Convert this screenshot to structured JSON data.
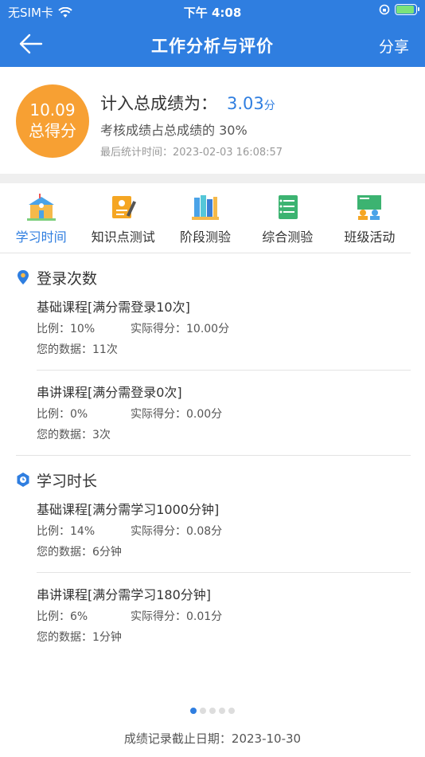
{
  "status": {
    "carrier": "无SIM卡",
    "time": "下午 4:08"
  },
  "nav": {
    "title": "工作分析与评价",
    "share": "分享"
  },
  "score": {
    "total": "10.09",
    "total_label": "总得分",
    "headline": "计入总成绩为：",
    "value": "3.03",
    "unit": "分",
    "subtitle": "考核成绩占总成绩的 30%",
    "stat_time": "最后统计时间：2023-02-03 16:08:57"
  },
  "tabs": [
    {
      "label": "学习时间",
      "icon": "school-icon",
      "active": true
    },
    {
      "label": "知识点测试",
      "icon": "id-card-icon",
      "active": false
    },
    {
      "label": "阶段测验",
      "icon": "books-icon",
      "active": false
    },
    {
      "label": "综合测验",
      "icon": "checklist-icon",
      "active": false
    },
    {
      "label": "班级活动",
      "icon": "classroom-icon",
      "active": false
    }
  ],
  "sections": [
    {
      "title": "登录次数",
      "icon": "location-pin-icon",
      "items": [
        {
          "name": "基础课程[满分需登录10次]",
          "ratio": "比例：10%",
          "score": "实际得分：10.00分",
          "data": "您的数据：11次"
        },
        {
          "name": "串讲课程[满分需登录0次]",
          "ratio": "比例：0%",
          "score": "实际得分：0.00分",
          "data": "您的数据：3次"
        }
      ]
    },
    {
      "title": "学习时长",
      "icon": "clock-icon",
      "items": [
        {
          "name": "基础课程[满分需学习1000分钟]",
          "ratio": "比例：14%",
          "score": "实际得分：0.08分",
          "data": "您的数据：6分钟"
        },
        {
          "name": "串讲课程[满分需学习180分钟]",
          "ratio": "比例：6%",
          "score": "实际得分：0.01分",
          "data": "您的数据：1分钟"
        }
      ]
    }
  ],
  "pager": {
    "pages": 5,
    "current": 1
  },
  "footer": "成绩记录截止日期：2023-10-30",
  "colors": {
    "primary": "#2f7ee0",
    "accent": "#f7a033"
  }
}
